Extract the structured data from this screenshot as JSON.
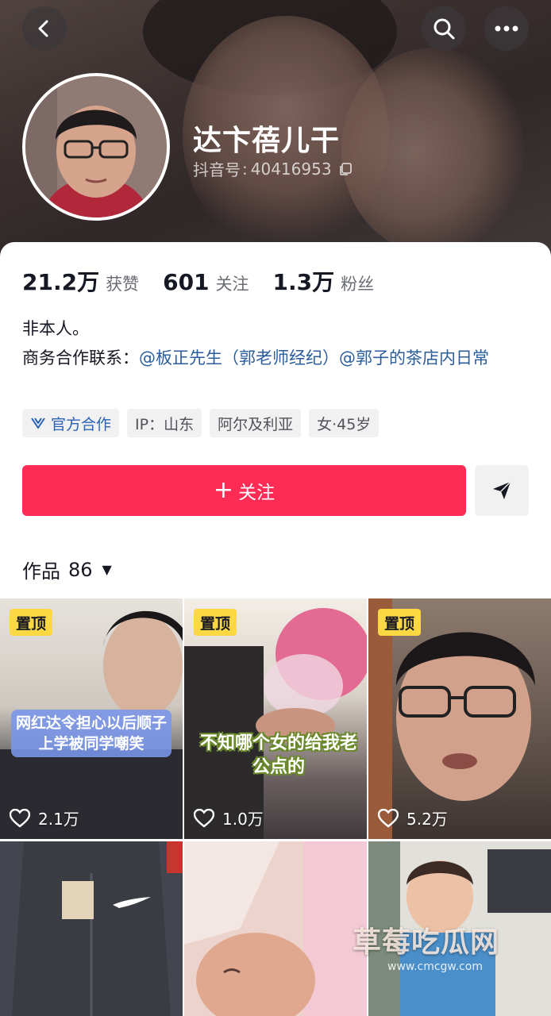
{
  "header": {
    "name": "达卞蓓儿干",
    "id_label": "抖音号",
    "id_sep": ":",
    "id_value": "40416953"
  },
  "stats": [
    {
      "value": "21.2万",
      "label": "获赞"
    },
    {
      "value": "601",
      "label": "关注"
    },
    {
      "value": "1.3万",
      "label": "粉丝"
    }
  ],
  "bio": {
    "line1": "非本人。",
    "contact_prefix": "商务合作联系：",
    "mention1": "@板正先生（郭老师经纪）",
    "mention2": "@郭子的茶店内日常"
  },
  "tags": [
    "官方合作",
    "IP：山东",
    "阿尔及利亚",
    "女·45岁"
  ],
  "follow_label": "关注",
  "works": {
    "label": "作品",
    "count": "86"
  },
  "videos": [
    {
      "pinned": "置顶",
      "likes": "2.1万",
      "caption": "网红达令担心以后顺子上学被同学嘲笑"
    },
    {
      "pinned": "置顶",
      "likes": "1.0万",
      "caption": "不知哪个女的给我老公点的"
    },
    {
      "pinned": "置顶",
      "likes": "5.2万",
      "caption": ""
    },
    {
      "pinned": "",
      "likes": "",
      "caption": ""
    },
    {
      "pinned": "",
      "likes": "",
      "caption": ""
    },
    {
      "pinned": "",
      "likes": "",
      "caption": ""
    }
  ],
  "watermark": {
    "text": "草莓吃瓜网",
    "url": "www.cmcgw.com"
  },
  "colors": {
    "accent": "#fe2c55",
    "pin": "#fcd844",
    "mention": "#2b5d9c"
  },
  "icons": [
    "back-icon",
    "search-icon",
    "more-icon",
    "copy-icon",
    "official-icon",
    "share-icon",
    "heart-icon",
    "dropdown-icon"
  ]
}
